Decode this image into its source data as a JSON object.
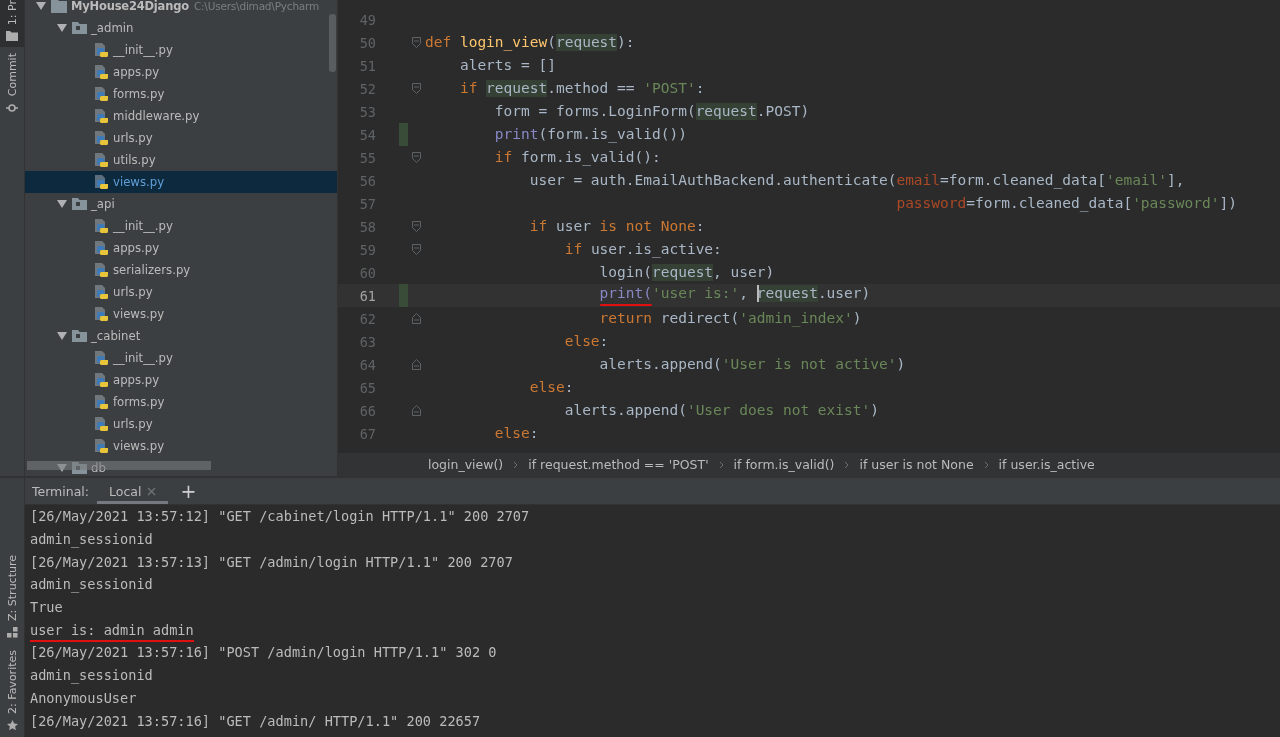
{
  "tool_strip": {
    "top": [
      {
        "label": "1: Pr",
        "selected": true
      },
      {
        "label": "Commit",
        "selected": false
      }
    ],
    "bottom": [
      {
        "label": "Z: Structure",
        "selected": false
      },
      {
        "label": "2: Favorites",
        "selected": false
      }
    ]
  },
  "project_tree": {
    "label": "MyHouse24Django",
    "path": "C:\\Users\\dimad\\Pycharm",
    "kind": "root",
    "expanded": true,
    "selected": false,
    "children": [
      {
        "label": "_admin",
        "kind": "folder",
        "expanded": true,
        "selected": false,
        "children": [
          {
            "label": "__init__.py",
            "kind": "file",
            "selected": false
          },
          {
            "label": "apps.py",
            "kind": "file",
            "selected": false
          },
          {
            "label": "forms.py",
            "kind": "file",
            "selected": false
          },
          {
            "label": "middleware.py",
            "kind": "file",
            "selected": false
          },
          {
            "label": "urls.py",
            "kind": "file",
            "selected": false
          },
          {
            "label": "utils.py",
            "kind": "file",
            "selected": false
          },
          {
            "label": "views.py",
            "kind": "file",
            "selected": true
          }
        ]
      },
      {
        "label": "_api",
        "kind": "folder",
        "expanded": true,
        "selected": false,
        "children": [
          {
            "label": "__init__.py",
            "kind": "file",
            "selected": false
          },
          {
            "label": "apps.py",
            "kind": "file",
            "selected": false
          },
          {
            "label": "serializers.py",
            "kind": "file",
            "selected": false
          },
          {
            "label": "urls.py",
            "kind": "file",
            "selected": false
          },
          {
            "label": "views.py",
            "kind": "file",
            "selected": false
          }
        ]
      },
      {
        "label": "_cabinet",
        "kind": "folder",
        "expanded": true,
        "selected": false,
        "children": [
          {
            "label": "__init__.py",
            "kind": "file",
            "selected": false
          },
          {
            "label": "apps.py",
            "kind": "file",
            "selected": false
          },
          {
            "label": "forms.py",
            "kind": "file",
            "selected": false
          },
          {
            "label": "urls.py",
            "kind": "file",
            "selected": false
          },
          {
            "label": "views.py",
            "kind": "file",
            "selected": false
          }
        ]
      },
      {
        "label": "db",
        "kind": "folder",
        "expanded": true,
        "selected": false
      }
    ]
  },
  "editor": {
    "lines": [
      {
        "number": "49",
        "changed": false,
        "current": false,
        "fold_start": false,
        "fold_end": false
      },
      {
        "number": "50",
        "changed": false,
        "current": false,
        "fold_start": true,
        "fold_end": false,
        "tokens": [
          {
            "t": "def ",
            "kind": "keyword"
          },
          {
            "t": "login_view",
            "kind": "function"
          },
          {
            "t": "(",
            "kind": "plain"
          },
          {
            "t": "request",
            "kind": "highlight"
          },
          {
            "t": "):",
            "kind": "plain"
          }
        ]
      },
      {
        "number": "51",
        "changed": false,
        "current": false,
        "fold_start": false,
        "fold_end": false,
        "tokens": [
          {
            "t": "    alerts = []",
            "kind": "plain"
          }
        ]
      },
      {
        "number": "52",
        "changed": false,
        "current": false,
        "fold_start": true,
        "fold_end": false,
        "tokens": [
          {
            "t": "    if ",
            "kind": "keyword"
          },
          {
            "t": "request",
            "kind": "highlight"
          },
          {
            "t": ".method == ",
            "kind": "plain"
          },
          {
            "t": "'POST'",
            "kind": "string"
          },
          {
            "t": ":",
            "kind": "plain"
          }
        ]
      },
      {
        "number": "53",
        "changed": false,
        "current": false,
        "fold_start": false,
        "fold_end": false,
        "tokens": [
          {
            "t": "        form = forms.LoginForm(",
            "kind": "plain"
          },
          {
            "t": "request",
            "kind": "highlight"
          },
          {
            "t": ".POST)",
            "kind": "plain"
          }
        ]
      },
      {
        "number": "54",
        "changed": true,
        "current": false,
        "fold_start": false,
        "fold_end": false,
        "tokens": [
          {
            "t": "        print",
            "kind": "builtin"
          },
          {
            "t": "(form.is_valid())",
            "kind": "plain"
          }
        ]
      },
      {
        "number": "55",
        "changed": false,
        "current": false,
        "fold_start": true,
        "fold_end": false,
        "tokens": [
          {
            "t": "        if ",
            "kind": "keyword"
          },
          {
            "t": "form.is_valid():",
            "kind": "plain"
          }
        ]
      },
      {
        "number": "56",
        "changed": false,
        "current": false,
        "fold_start": false,
        "fold_end": false,
        "tokens": [
          {
            "t": "            user = auth.EmailAuthBackend.authenticate(",
            "kind": "plain"
          },
          {
            "t": "email",
            "kind": "param"
          },
          {
            "t": "=form.cleaned_data[",
            "kind": "plain"
          },
          {
            "t": "'email'",
            "kind": "string"
          },
          {
            "t": "],",
            "kind": "plain"
          }
        ]
      },
      {
        "number": "57",
        "changed": false,
        "current": false,
        "fold_start": false,
        "fold_end": false,
        "tokens": [
          {
            "t": "                                                      password",
            "kind": "param"
          },
          {
            "t": "=form.cleaned_data[",
            "kind": "plain"
          },
          {
            "t": "'password'",
            "kind": "string"
          },
          {
            "t": "])",
            "kind": "plain"
          }
        ]
      },
      {
        "number": "58",
        "changed": false,
        "current": false,
        "fold_start": true,
        "fold_end": false,
        "tokens": [
          {
            "t": "            if ",
            "kind": "keyword"
          },
          {
            "t": "user ",
            "kind": "plain"
          },
          {
            "t": "is not None",
            "kind": "keyword"
          },
          {
            "t": ":",
            "kind": "plain"
          }
        ]
      },
      {
        "number": "59",
        "changed": false,
        "current": false,
        "fold_start": true,
        "fold_end": false,
        "tokens": [
          {
            "t": "                if ",
            "kind": "keyword"
          },
          {
            "t": "user.is_active:",
            "kind": "plain"
          }
        ]
      },
      {
        "number": "60",
        "changed": false,
        "current": false,
        "fold_start": false,
        "fold_end": false,
        "tokens": [
          {
            "t": "                    login(",
            "kind": "plain"
          },
          {
            "t": "request",
            "kind": "highlight"
          },
          {
            "t": ", user)",
            "kind": "plain"
          }
        ]
      },
      {
        "number": "61",
        "changed": true,
        "current": true,
        "fold_start": false,
        "fold_end": false,
        "tokens": [
          {
            "t": "                    print(",
            "kind": "builtin",
            "underlined": true
          },
          {
            "t": "'user is:'",
            "kind": "string"
          },
          {
            "t": ", ",
            "kind": "plain"
          },
          {
            "t": "request",
            "kind": "highlight",
            "caret": true
          },
          {
            "t": ".user)",
            "kind": "plain"
          }
        ]
      },
      {
        "number": "62",
        "changed": false,
        "current": false,
        "fold_start": false,
        "fold_end": true,
        "tokens": [
          {
            "t": "                    return ",
            "kind": "keyword"
          },
          {
            "t": "redirect(",
            "kind": "plain"
          },
          {
            "t": "'admin_index'",
            "kind": "string"
          },
          {
            "t": ")",
            "kind": "plain"
          }
        ]
      },
      {
        "number": "63",
        "changed": false,
        "current": false,
        "fold_start": false,
        "fold_end": false,
        "tokens": [
          {
            "t": "                else",
            "kind": "keyword"
          },
          {
            "t": ":",
            "kind": "plain"
          }
        ]
      },
      {
        "number": "64",
        "changed": false,
        "current": false,
        "fold_start": false,
        "fold_end": true,
        "tokens": [
          {
            "t": "                    alerts.append(",
            "kind": "plain"
          },
          {
            "t": "'User is not active'",
            "kind": "string"
          },
          {
            "t": ")",
            "kind": "plain"
          }
        ]
      },
      {
        "number": "65",
        "changed": false,
        "current": false,
        "fold_start": false,
        "fold_end": false,
        "tokens": [
          {
            "t": "            else",
            "kind": "keyword"
          },
          {
            "t": ":",
            "kind": "plain"
          }
        ]
      },
      {
        "number": "66",
        "changed": false,
        "current": false,
        "fold_start": false,
        "fold_end": true,
        "tokens": [
          {
            "t": "                alerts.append(",
            "kind": "plain"
          },
          {
            "t": "'User does not exist'",
            "kind": "string"
          },
          {
            "t": ")",
            "kind": "plain"
          }
        ]
      },
      {
        "number": "67",
        "changed": false,
        "current": false,
        "fold_start": false,
        "fold_end": false,
        "tokens": [
          {
            "t": "        else",
            "kind": "keyword"
          },
          {
            "t": ":",
            "kind": "plain"
          }
        ]
      }
    ],
    "breadcrumbs": [
      "login_view()",
      "if request.method == 'POST'",
      "if form.is_valid()",
      "if user is not None",
      "if user.is_active"
    ]
  },
  "terminal": {
    "title": "Terminal:",
    "tabs": [
      {
        "label": "Local",
        "selected": true,
        "closable": true
      }
    ],
    "new_tab": "+",
    "lines": [
      {
        "text": "[26/May/2021 13:57:12] \"GET /cabinet/login HTTP/1.1\" 200 2707",
        "underlined": false
      },
      {
        "text": "admin_sessionid",
        "underlined": false
      },
      {
        "text": "[26/May/2021 13:57:13] \"GET /admin/login HTTP/1.1\" 200 2707",
        "underlined": false
      },
      {
        "text": "admin_sessionid",
        "underlined": false
      },
      {
        "text": "True",
        "underlined": false
      },
      {
        "text": "user is: admin admin",
        "underlined": true
      },
      {
        "text": "[26/May/2021 13:57:16] \"POST /admin/login HTTP/1.1\" 302 0",
        "underlined": false
      },
      {
        "text": "admin_sessionid",
        "underlined": false
      },
      {
        "text": "AnonymousUser",
        "underlined": false
      },
      {
        "text": "[26/May/2021 13:57:16] \"GET /admin/ HTTP/1.1\" 200 22657",
        "underlined": false
      }
    ]
  }
}
